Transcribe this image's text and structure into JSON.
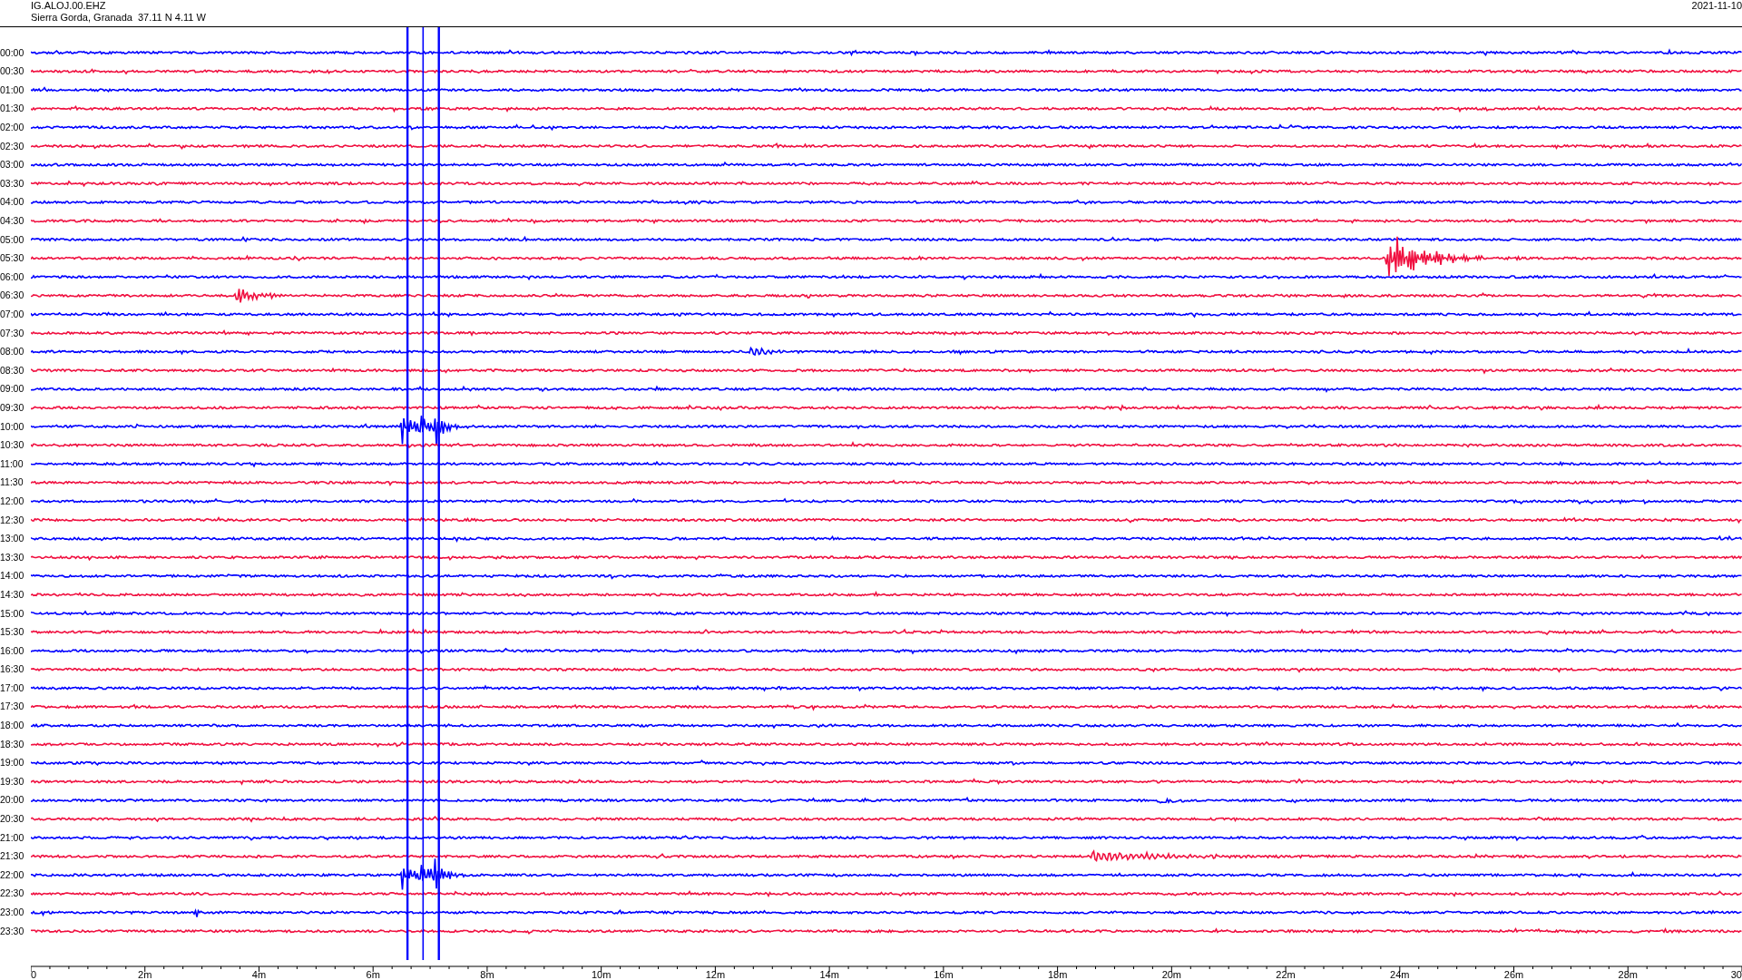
{
  "header": {
    "station": "IG.ALOJ.00.EHZ",
    "location": "Sierra Gorda, Granada  37.11 N 4.11 W",
    "date": "2021-11-10"
  },
  "traces": [
    {
      "time": "00:00",
      "color": "#0000ff"
    },
    {
      "time": "00:30",
      "color": "#f01040"
    },
    {
      "time": "01:00",
      "color": "#0000ff"
    },
    {
      "time": "01:30",
      "color": "#f01040"
    },
    {
      "time": "02:00",
      "color": "#0000ff"
    },
    {
      "time": "02:30",
      "color": "#f01040"
    },
    {
      "time": "03:00",
      "color": "#0000ff"
    },
    {
      "time": "03:30",
      "color": "#f01040"
    },
    {
      "time": "04:00",
      "color": "#0000ff"
    },
    {
      "time": "04:30",
      "color": "#f01040"
    },
    {
      "time": "05:00",
      "color": "#0000ff"
    },
    {
      "time": "05:30",
      "color": "#f01040"
    },
    {
      "time": "06:00",
      "color": "#0000ff"
    },
    {
      "time": "06:30",
      "color": "#f01040"
    },
    {
      "time": "07:00",
      "color": "#0000ff"
    },
    {
      "time": "07:30",
      "color": "#f01040"
    },
    {
      "time": "08:00",
      "color": "#0000ff"
    },
    {
      "time": "08:30",
      "color": "#f01040"
    },
    {
      "time": "09:00",
      "color": "#0000ff"
    },
    {
      "time": "09:30",
      "color": "#f01040"
    },
    {
      "time": "10:00",
      "color": "#0000ff"
    },
    {
      "time": "10:30",
      "color": "#f01040"
    },
    {
      "time": "11:00",
      "color": "#0000ff"
    },
    {
      "time": "11:30",
      "color": "#f01040"
    },
    {
      "time": "12:00",
      "color": "#0000ff"
    },
    {
      "time": "12:30",
      "color": "#f01040"
    },
    {
      "time": "13:00",
      "color": "#0000ff"
    },
    {
      "time": "13:30",
      "color": "#f01040"
    },
    {
      "time": "14:00",
      "color": "#0000ff"
    },
    {
      "time": "14:30",
      "color": "#f01040"
    },
    {
      "time": "15:00",
      "color": "#0000ff"
    },
    {
      "time": "15:30",
      "color": "#f01040"
    },
    {
      "time": "16:00",
      "color": "#0000ff"
    },
    {
      "time": "16:30",
      "color": "#f01040"
    },
    {
      "time": "17:00",
      "color": "#0000ff"
    },
    {
      "time": "17:30",
      "color": "#f01040"
    },
    {
      "time": "18:00",
      "color": "#0000ff"
    },
    {
      "time": "18:30",
      "color": "#f01040"
    },
    {
      "time": "19:00",
      "color": "#0000ff"
    },
    {
      "time": "19:30",
      "color": "#f01040"
    },
    {
      "time": "20:00",
      "color": "#0000ff"
    },
    {
      "time": "20:30",
      "color": "#f01040"
    },
    {
      "time": "21:00",
      "color": "#0000ff"
    },
    {
      "time": "21:30",
      "color": "#f01040"
    },
    {
      "time": "22:00",
      "color": "#0000ff"
    },
    {
      "time": "22:30",
      "color": "#f01040"
    },
    {
      "time": "23:00",
      "color": "#0000ff"
    },
    {
      "time": "23:30",
      "color": "#f01040"
    }
  ],
  "x_axis": {
    "ticks": [
      "0",
      "2m",
      "4m",
      "6m",
      "8m",
      "10m",
      "12m",
      "14m",
      "16m",
      "18m",
      "20m",
      "22m",
      "24m",
      "26m",
      "28m",
      "30"
    ]
  }
}
